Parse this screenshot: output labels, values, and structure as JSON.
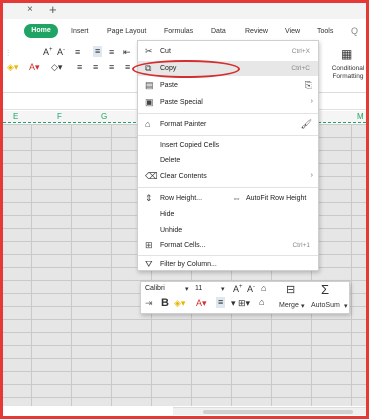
{
  "tabstrip": {
    "close_glyph": "×",
    "new_tab_glyph": "+"
  },
  "ribbon_tabs": [
    "Home",
    "Insert",
    "Page Layout",
    "Formulas",
    "Data",
    "Review",
    "View",
    "Tools"
  ],
  "ribbon": {
    "conditional_formatting": "Conditional Formatting",
    "search_glyph": "Q"
  },
  "column_headers": [
    "E",
    "F",
    "G",
    "M"
  ],
  "context_menu": {
    "cut": {
      "label": "Cut",
      "shortcut": "Ctrl+X"
    },
    "copy": {
      "label": "Copy",
      "shortcut": "Ctrl+C"
    },
    "paste": {
      "label": "Paste"
    },
    "paste_special": {
      "label": "Paste Special"
    },
    "format_painter": {
      "label": "Format Painter"
    },
    "insert_copied_cells": {
      "label": "Insert Copied Cells"
    },
    "delete": {
      "label": "Delete"
    },
    "clear_contents": {
      "label": "Clear Contents"
    },
    "row_height": {
      "label": "Row Height..."
    },
    "autofit_row_height": {
      "label": "AutoFit Row Height"
    },
    "hide": {
      "label": "Hide"
    },
    "unhide": {
      "label": "Unhide"
    },
    "format_cells": {
      "label": "Format Cells...",
      "shortcut": "Ctrl+1"
    },
    "filter_by_column": {
      "label": "Filter by Column..."
    }
  },
  "mini_toolbar": {
    "font_name": "Calibri",
    "font_size": "11",
    "merge": "Merge",
    "autosum": "AutoSum",
    "bold": "B"
  },
  "colors": {
    "accent": "#1fa463",
    "annotation": "#d32f2f",
    "border": "#e53935"
  },
  "icons": [
    "close-icon",
    "new-tab-icon",
    "cut-icon",
    "copy-icon",
    "paste-icon",
    "paste-special-icon",
    "format-painter-icon",
    "clear-contents-icon",
    "row-height-icon",
    "autofit-icon",
    "format-cells-icon",
    "filter-icon",
    "autosum-icon",
    "merge-icon"
  ]
}
